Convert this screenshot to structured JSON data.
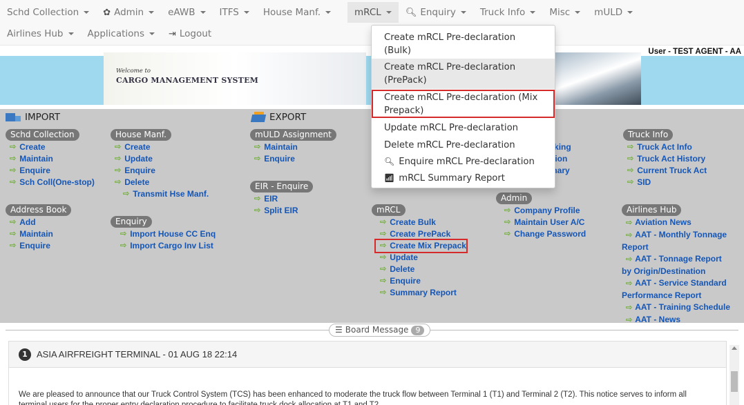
{
  "nav": {
    "row1": [
      {
        "label": "Schd Collection",
        "caret": true
      },
      {
        "label": "Admin",
        "caret": true,
        "icon": "gear-icon",
        "glyph": "✿"
      },
      {
        "label": "eAWB",
        "caret": true
      },
      {
        "label": "ITFS",
        "caret": true
      },
      {
        "label": "House Manf.",
        "caret": true
      },
      {
        "label": "mRCL",
        "caret": true,
        "active": true
      },
      {
        "label": "Enquiry",
        "caret": true,
        "icon": "search-icon",
        "glyph": "🔍︎"
      },
      {
        "label": "Truck Info",
        "caret": true
      },
      {
        "label": "Misc",
        "caret": true
      },
      {
        "label": "mULD",
        "caret": true
      }
    ],
    "row2": [
      {
        "label": "Airlines Hub",
        "caret": true
      },
      {
        "label": "Applications",
        "caret": true
      },
      {
        "label": "Logout",
        "caret": false,
        "icon": "logout-icon",
        "glyph": "⇥"
      }
    ]
  },
  "banner": {
    "user": "User - TEST AGENT - AA",
    "welcome_small": "Welcome to",
    "welcome_big": "CARGO MANAGEMENT SYSTEM"
  },
  "sections": {
    "import_title": "IMPORT",
    "export_title": "EXPORT"
  },
  "groups": {
    "schd_collection": {
      "title": "Schd Collection",
      "links": [
        "Create",
        "Maintain",
        "Enquire",
        "Sch Coll(One-stop)"
      ]
    },
    "house_manf": {
      "title": "House Manf.",
      "links": [
        "Create",
        "Update",
        "Enquire",
        "Delete",
        "Transmit Hse Manf."
      ]
    },
    "muld_assignment": {
      "title": "mULD Assignment",
      "links": [
        "Maintain",
        "Enquire"
      ]
    },
    "eir_enquire": {
      "title": "EIR - Enquire",
      "links": [
        "EIR",
        "Split EIR"
      ]
    },
    "truck_info": {
      "title": "Truck Info",
      "links": [
        "Truck Act Info",
        "Truck Act History",
        "Current Truck Act",
        "SID"
      ]
    },
    "truck_partial": {
      "links": [
        "t Tracking",
        "ormation",
        "Summary"
      ]
    },
    "address_book": {
      "title": "Address Book",
      "links": [
        "Add",
        "Maintain",
        "Enquire"
      ]
    },
    "enquiry": {
      "title": "Enquiry",
      "links": [
        "Import House CC Enq",
        "Import Cargo Inv List"
      ]
    },
    "mrcl": {
      "title": "mRCL",
      "links": [
        "Create Bulk",
        "Create PrePack",
        "Create Mix Prepack",
        "Update",
        "Delete",
        "Enquire",
        "Summary Report"
      ]
    },
    "admin": {
      "title": "Admin",
      "links": [
        "Company Profile",
        "Maintain User A/C",
        "Change Password"
      ]
    },
    "airlines_hub": {
      "title": "Airlines Hub",
      "links": [
        [
          "Aviation News"
        ],
        [
          "AAT - Monthly Tonnage",
          "Report"
        ],
        [
          "AAT - Tonnage Report",
          "by Origin/Destination"
        ],
        [
          "AAT - Service Standard",
          "Performance Report"
        ],
        [
          "AAT - Training Schedule"
        ],
        [
          "AAT - News"
        ]
      ]
    }
  },
  "dropdown": {
    "items": [
      {
        "line1": "Create mRCL Pre-declaration",
        "line2": "(Bulk)"
      },
      {
        "line1": "Create mRCL Pre-declaration",
        "line2": "(PrePack)"
      },
      {
        "line1": "Create mRCL Pre-declaration (Mix",
        "line2": "Prepack)"
      },
      {
        "line1": "Update mRCL Pre-declaration"
      },
      {
        "line1": "Delete mRCL Pre-declaration"
      },
      {
        "line1": "Enquire mRCL Pre-declaration",
        "icon": "search-icon",
        "glyph": "🔍︎"
      },
      {
        "line1": "mRCL Summary Report",
        "icon": "bar-chart-icon",
        "glyph": "📶︎"
      }
    ]
  },
  "board": {
    "label": "Board Message",
    "count": "9",
    "message_number": "1",
    "message_title": "ASIA AIRFREIGHT TERMINAL - 01 AUG 18 22:14",
    "message_body": "We are pleased to announce that our Truck Control System (TCS) has been enhanced to moderate the truck flow between Terminal 1 (T1) and Terminal 2 (T2). This notice serves to inform all terminal users for the proper entry declaration procedure to facilitate truck dock allocation at T1 and T2."
  },
  "colors": {
    "link": "#1456b8",
    "badge": "#777777",
    "highlight": "#d62a2a",
    "main_bg": "#c9c9c9",
    "banner_bg": "#9fd9ef"
  }
}
